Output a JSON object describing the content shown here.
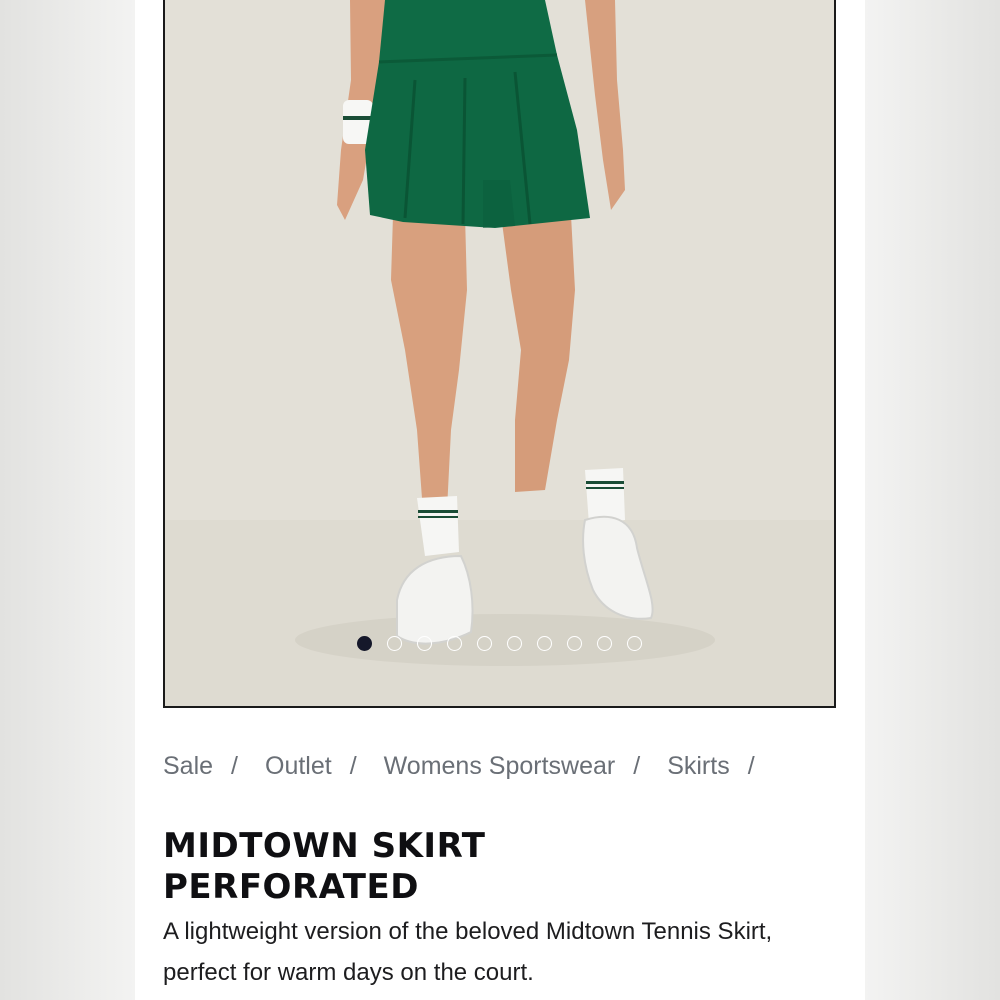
{
  "gallery": {
    "image_alt": "Model wearing green Midtown Skirt Perforated with white socks and white sneakers",
    "slide_count": 10,
    "active_slide": 1,
    "colors": {
      "skirt": "#0f6b45",
      "background": "#e3e0d7",
      "active_dot": "#15182a"
    }
  },
  "breadcrumb": {
    "items": [
      "Sale",
      "Outlet",
      "Womens Sportswear",
      "Skirts"
    ],
    "separator": "/"
  },
  "product": {
    "title_line1": "MIDTOWN SKIRT",
    "title_line2": "PERFORATED",
    "description": "A lightweight version of the beloved Midtown Tennis Skirt, perfect for warm days on the court."
  },
  "chat": {
    "icon": "chat-bubble-icon"
  }
}
